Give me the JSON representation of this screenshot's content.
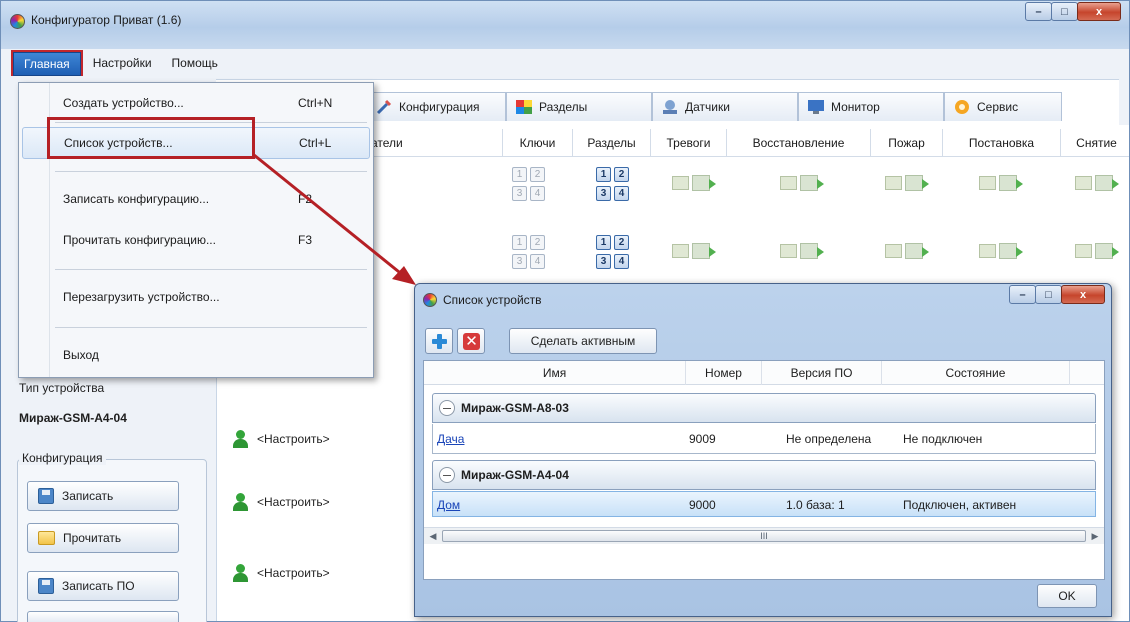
{
  "window": {
    "title": "Конфигуратор Приват (1.6)",
    "controls": {
      "minimize": "–",
      "maximize": "□",
      "close": "x"
    }
  },
  "menubar": {
    "items": [
      {
        "label": "Главная",
        "active": true
      },
      {
        "label": "Настройки"
      },
      {
        "label": "Помощь"
      }
    ]
  },
  "dropdown": {
    "items": [
      {
        "label": "Создать устройство...",
        "shortcut": "Ctrl+N"
      },
      {
        "label": "Список устройств...",
        "shortcut": "Ctrl+L",
        "highlighted": true
      },
      {
        "label": "Записать конфигурацию...",
        "shortcut": "F2"
      },
      {
        "label": "Прочитать конфигурацию...",
        "shortcut": "F3"
      },
      {
        "label": "Перезагрузить устройство..."
      },
      {
        "label": "Выход"
      }
    ]
  },
  "tabs": [
    {
      "label": "Конфигурация",
      "icon": "config-icon"
    },
    {
      "label": "Разделы",
      "icon": "sections-icon"
    },
    {
      "label": "Датчики",
      "icon": "sensors-icon"
    },
    {
      "label": "Монитор",
      "icon": "monitor-icon"
    },
    {
      "label": "Сервис",
      "icon": "service-icon"
    }
  ],
  "table_header": {
    "users_partial": "атели",
    "keys": "Ключи",
    "sections": "Разделы",
    "alarms": "Тревоги",
    "restore": "Восстановление",
    "fire": "Пожар",
    "arm": "Постановка",
    "disarm": "Снятие"
  },
  "key_numbers": [
    "1",
    "2",
    "3",
    "4"
  ],
  "users": [
    {
      "label": "<Настроить>"
    },
    {
      "label": "<Настроить>"
    },
    {
      "label": "<Настроить>"
    }
  ],
  "left_panel": {
    "device_type_label": "Тип устройства",
    "device_type_value": "Мираж-GSM-A4-04",
    "group_title": "Конфигурация",
    "buttons": [
      {
        "label": "Записать",
        "icon": "save-disk-icon"
      },
      {
        "label": "Прочитать",
        "icon": "open-folder-icon"
      },
      {
        "label": "Записать ПО",
        "icon": "save-disk-icon"
      }
    ]
  },
  "dialog": {
    "title": "Список устройств",
    "toolbar": {
      "activate_label": "Сделать активным"
    },
    "columns": [
      "Имя",
      "Номер",
      "Версия ПО",
      "Состояние"
    ],
    "groups": [
      {
        "name": "Мираж-GSM-A8-03",
        "devices": [
          {
            "name": "Дача",
            "number": "9009",
            "version": "Не определена",
            "status": "Не подключен",
            "selected": false
          }
        ]
      },
      {
        "name": "Мираж-GSM-A4-04",
        "devices": [
          {
            "name": "Дом",
            "number": "9000",
            "version": "1.0 база: 1",
            "status": "Подключен, активен",
            "selected": true
          }
        ]
      }
    ],
    "scroll_grip": "III",
    "ok_label": "OK"
  },
  "colors": {
    "highlight_frame": "#b52025",
    "menu_active": "#1f5fb4",
    "link": "#1a45b8"
  }
}
